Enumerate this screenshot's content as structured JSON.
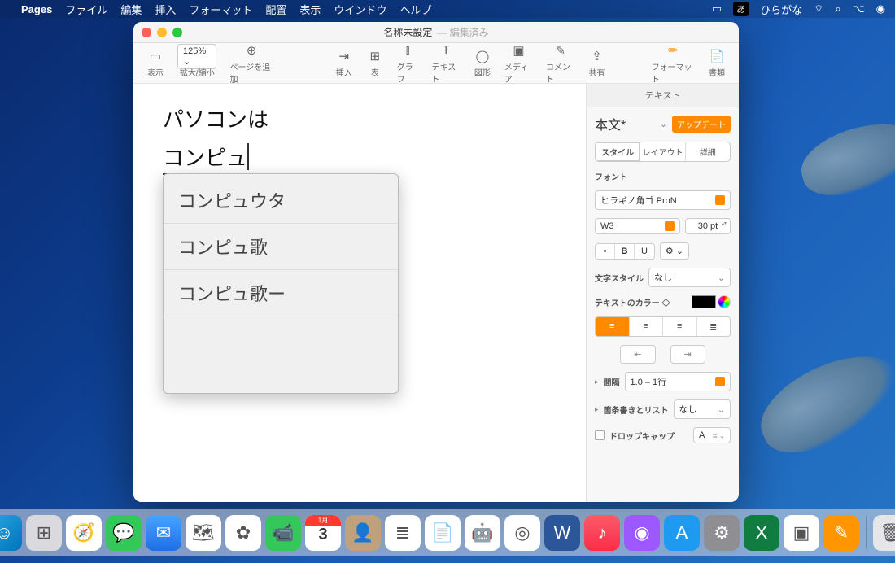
{
  "menubar": {
    "app": "Pages",
    "items": [
      "ファイル",
      "編集",
      "挿入",
      "フォーマット",
      "配置",
      "表示",
      "ウインドウ",
      "ヘルプ"
    ],
    "ime_indicator": "あ",
    "ime_label": "ひらがな"
  },
  "window": {
    "title": "名称未設定",
    "subtitle": "— 編集済み"
  },
  "toolbar": {
    "view": "表示",
    "zoom_value": "125%",
    "zoom_label": "拡大/縮小",
    "add_page": "ページを追加",
    "insert": "挿入",
    "table": "表",
    "chart": "グラフ",
    "text": "テキスト",
    "shape": "図形",
    "media": "メディア",
    "comment": "コメント",
    "share": "共有",
    "format": "フォーマット",
    "document": "書類"
  },
  "content": {
    "line1": "パソコンは",
    "line2": "コンピュ"
  },
  "ime_candidates": [
    "コンピュウタ",
    "コンピュ歌",
    "コンピュ歌ー"
  ],
  "inspector": {
    "header": "テキスト",
    "paragraph_style": "本文*",
    "update_btn": "アップデート",
    "tabs": {
      "style": "スタイル",
      "layout": "レイアウト",
      "more": "詳細"
    },
    "font_label": "フォント",
    "font_name": "ヒラギノ角ゴ ProN",
    "font_weight": "W3",
    "font_size": "30 pt",
    "char_style_label": "文字スタイル",
    "char_style_value": "なし",
    "text_color_label": "テキストのカラー ◇",
    "spacing_label": "間隔",
    "spacing_value": "1.0 – 1行",
    "bullets_label": "箇条書きとリスト",
    "bullets_value": "なし",
    "dropcap_label": "ドロップキャップ",
    "dropcap_value": "A"
  },
  "dock": [
    {
      "name": "finder",
      "bg": "linear-gradient(135deg,#29abe2,#0071bc)",
      "glyph": "☺"
    },
    {
      "name": "launchpad",
      "bg": "#d9d9de",
      "glyph": "⊞"
    },
    {
      "name": "safari",
      "bg": "#fff",
      "glyph": "🧭"
    },
    {
      "name": "messages",
      "bg": "#34c759",
      "glyph": "💬"
    },
    {
      "name": "mail",
      "bg": "linear-gradient(#4aa3ff,#1e6fe6)",
      "glyph": "✉"
    },
    {
      "name": "maps",
      "bg": "#fff",
      "glyph": "🗺"
    },
    {
      "name": "photos",
      "bg": "#fff",
      "glyph": "✿"
    },
    {
      "name": "facetime",
      "bg": "#34c759",
      "glyph": "📹"
    },
    {
      "name": "calendar",
      "bg": "#fff",
      "glyph": "3",
      "badge": "1月"
    },
    {
      "name": "contacts",
      "bg": "#bfa27b",
      "glyph": "👤"
    },
    {
      "name": "reminders",
      "bg": "#fff",
      "glyph": "≣"
    },
    {
      "name": "notes",
      "bg": "#fff",
      "glyph": "📄"
    },
    {
      "name": "automator",
      "bg": "#fff",
      "glyph": "🤖"
    },
    {
      "name": "chrome",
      "bg": "#fff",
      "glyph": "◎"
    },
    {
      "name": "word",
      "bg": "#2b579a",
      "glyph": "W"
    },
    {
      "name": "music",
      "bg": "linear-gradient(#fb5b6a,#fa2d48)",
      "glyph": "♪"
    },
    {
      "name": "podcasts",
      "bg": "#9b59ff",
      "glyph": "◉"
    },
    {
      "name": "appstore",
      "bg": "#1e9bf0",
      "glyph": "A"
    },
    {
      "name": "preferences",
      "bg": "#8e8e93",
      "glyph": "⚙"
    },
    {
      "name": "excel",
      "bg": "#107c41",
      "glyph": "X"
    },
    {
      "name": "screenshot",
      "bg": "#fff",
      "glyph": "▣"
    },
    {
      "name": "pages",
      "bg": "#ff9500",
      "glyph": "✎"
    },
    {
      "name": "trash",
      "bg": "#e5e5ea",
      "glyph": "🗑"
    }
  ]
}
